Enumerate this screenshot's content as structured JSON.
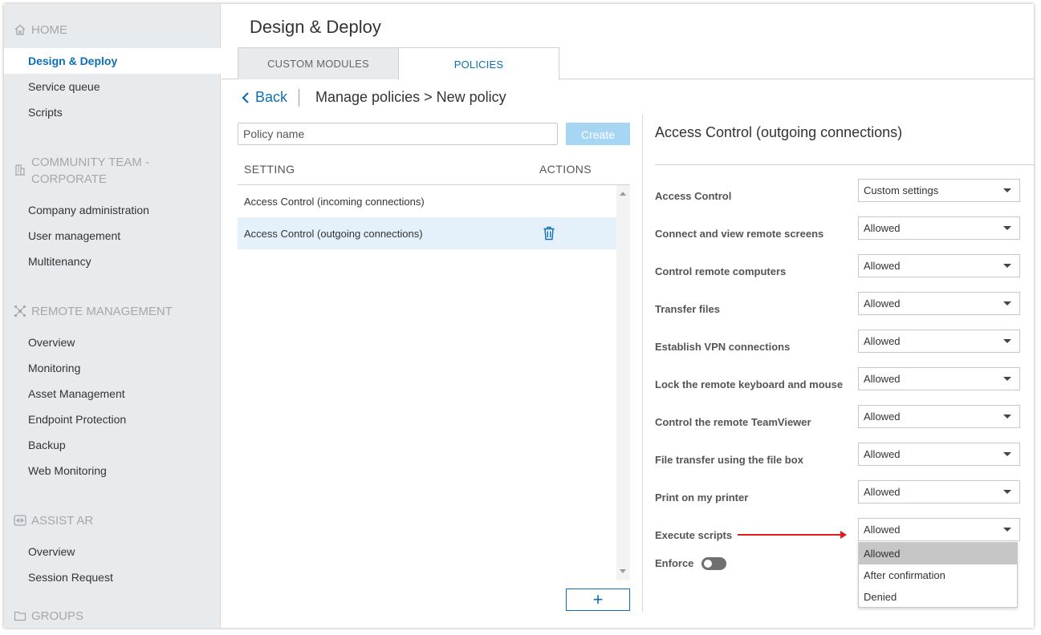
{
  "sidebar": {
    "sections": [
      {
        "title": "HOME",
        "icon": "home-icon"
      },
      {
        "title": "COMMUNITY TEAM -",
        "title2": "CORPORATE",
        "icon": "building-icon"
      },
      {
        "title": "REMOTE MANAGEMENT",
        "icon": "network-icon"
      },
      {
        "title": "ASSIST AR",
        "icon": "assist-ar-icon"
      },
      {
        "title": "GROUPS",
        "icon": "folder-icon"
      }
    ],
    "items": [
      {
        "label": "Design & Deploy"
      },
      {
        "label": "Service queue"
      },
      {
        "label": "Scripts"
      },
      {
        "label": "Company administration"
      },
      {
        "label": "User management"
      },
      {
        "label": "Multitenancy"
      },
      {
        "label": "Overview"
      },
      {
        "label": "Monitoring"
      },
      {
        "label": "Asset Management"
      },
      {
        "label": "Endpoint Protection"
      },
      {
        "label": "Backup"
      },
      {
        "label": "Web Monitoring"
      },
      {
        "label": "Overview"
      },
      {
        "label": "Session Request"
      }
    ]
  },
  "main": {
    "title": "Design & Deploy",
    "tabs": [
      {
        "label": "CUSTOM MODULES"
      },
      {
        "label": "POLICIES"
      }
    ],
    "back_label": "Back",
    "breadcrumb": "Manage policies > New policy",
    "policy_name_placeholder": "Policy name",
    "create_label": "Create",
    "columns": {
      "setting": "SETTING",
      "actions": "ACTIONS"
    },
    "settings_rows": [
      {
        "label": "Access Control (incoming connections)"
      },
      {
        "label": "Access Control (outgoing connections)"
      }
    ],
    "add_label": "+"
  },
  "detail": {
    "title": "Access Control (outgoing connections)",
    "settings": [
      {
        "label": "Access Control",
        "value": "Custom settings"
      },
      {
        "label": "Connect and view remote screens",
        "value": "Allowed"
      },
      {
        "label": "Control remote computers",
        "value": "Allowed"
      },
      {
        "label": "Transfer files",
        "value": "Allowed"
      },
      {
        "label": "Establish VPN connections",
        "value": "Allowed"
      },
      {
        "label": "Lock the remote keyboard and mouse",
        "value": "Allowed"
      },
      {
        "label": "Control the remote TeamViewer",
        "value": "Allowed"
      },
      {
        "label": "File transfer using the file box",
        "value": "Allowed"
      },
      {
        "label": "Print on my printer",
        "value": "Allowed"
      },
      {
        "label": "Execute scripts",
        "value": "Allowed"
      }
    ],
    "enforce_label": "Enforce",
    "enforce_on": false,
    "dropdown_options": [
      "Allowed",
      "After confirmation",
      "Denied"
    ]
  },
  "colors": {
    "accent": "#0e6fb6",
    "sidebar_bg": "#e8ebee",
    "annotation_arrow": "#e01b1b"
  }
}
